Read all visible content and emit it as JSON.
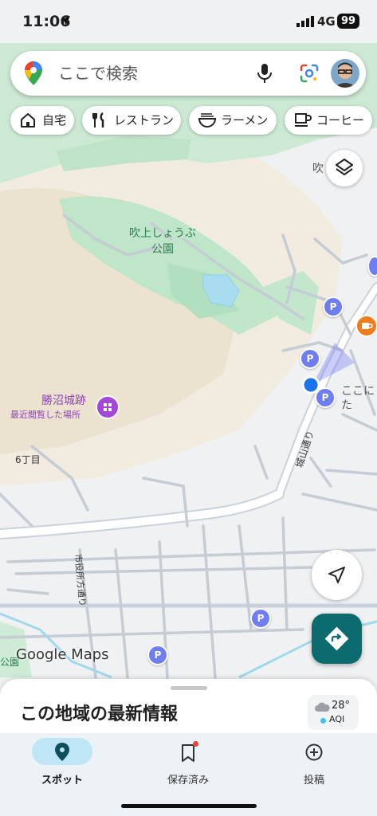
{
  "status_bar": {
    "time": "11:06",
    "network": "4G",
    "battery": "99"
  },
  "search": {
    "placeholder": "ここで検索"
  },
  "chips": [
    {
      "label": "自宅",
      "icon": "home-icon"
    },
    {
      "label": "レストラン",
      "icon": "restaurant-icon"
    },
    {
      "label": "ラーメン",
      "icon": "ramen-icon"
    },
    {
      "label": "コーヒー",
      "icon": "coffee-icon"
    }
  ],
  "map": {
    "labels": {
      "park": "吹上しょうぶ\n公園",
      "castle": "勝沼城跡",
      "castle_sub": "最近閲覧した場所",
      "district": "6丁目",
      "road_castle": "城山通り",
      "road_city": "市役所方通り",
      "partial_top": "吹",
      "partial_here": "ここに",
      "partial_here2": "た",
      "partial_park": "公園"
    },
    "parking_label": "P",
    "logo": "Google Maps"
  },
  "sheet": {
    "title": "この地域の最新情報"
  },
  "weather": {
    "temp": "28°",
    "aqi": "AQI"
  },
  "nav": [
    {
      "label": "スポット",
      "icon": "explore-pin-icon"
    },
    {
      "label": "保存済み",
      "icon": "bookmark-icon"
    },
    {
      "label": "投稿",
      "icon": "add-circle-icon"
    }
  ],
  "colors": {
    "accent": "#0b6b6f",
    "park": "#bfe6c9",
    "water": "#a8dcf0",
    "parking": "#6e7ef2"
  }
}
